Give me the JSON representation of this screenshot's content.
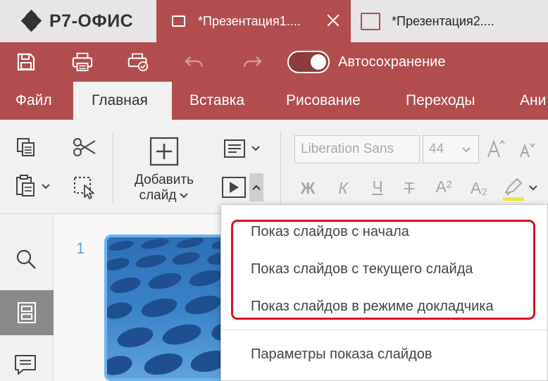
{
  "app": {
    "logo_text": "Р7-ОФИС"
  },
  "tabs": [
    {
      "label": "*Презентация1...."
    },
    {
      "label": "*Презентация2...."
    }
  ],
  "quick_access": {
    "autosave_label": "Автосохранение",
    "autosave_on": true
  },
  "menu": {
    "items": [
      "Файл",
      "Главная",
      "Вставка",
      "Рисование",
      "Переходы",
      "Ани"
    ],
    "active": "Главная"
  },
  "toolbar": {
    "add_slide_label_1": "Добавить",
    "add_slide_label_2": "слайд",
    "font_name": "Liberation Sans",
    "font_size": "44",
    "bold_glyph": "Ж",
    "italic_glyph": "К",
    "underline_glyph": "Ч",
    "strike_glyph": "Т",
    "superscript_glyph": "A²",
    "subscript_glyph": "A₂"
  },
  "slides_panel": {
    "slide_number": "1"
  },
  "dropdown": {
    "items": [
      "Показ слайдов с начала",
      "Показ слайдов с текущего слайда",
      "Показ слайдов в режиме докладчика"
    ],
    "settings_item": "Параметры показа слайдов"
  },
  "colors": {
    "brand": "#b24d4e",
    "highlight_border": "#d8141c",
    "slide_number": "#5aa4de",
    "highlighter_swatch": "#f3e640"
  }
}
